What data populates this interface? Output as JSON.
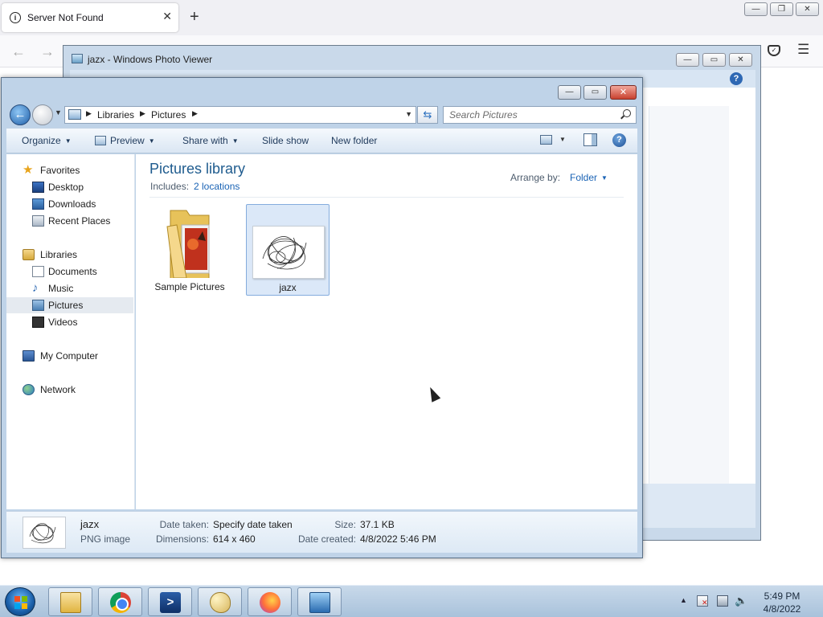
{
  "browser": {
    "tab_title": "Server Not Found",
    "tab_close": "✕",
    "new_tab": "+",
    "back": "←",
    "forward": "→",
    "menu": "☰"
  },
  "photo_viewer": {
    "title": "jazx - Windows Photo Viewer",
    "help": "?"
  },
  "explorer": {
    "address": {
      "crumbs": [
        "Libraries",
        "Pictures"
      ],
      "separator": "▶"
    },
    "search_placeholder": "Search Pictures",
    "toolbar": {
      "organize": "Organize",
      "preview": "Preview",
      "share_with": "Share with",
      "slide_show": "Slide show",
      "new_folder": "New folder",
      "help": "?"
    },
    "nav": {
      "favorites": "Favorites",
      "desktop": "Desktop",
      "downloads": "Downloads",
      "recent_places": "Recent Places",
      "libraries": "Libraries",
      "documents": "Documents",
      "music": "Music",
      "pictures": "Pictures",
      "videos": "Videos",
      "my_computer": "My Computer",
      "network": "Network"
    },
    "content": {
      "title": "Pictures library",
      "includes_label": "Includes:",
      "includes_link": "2 locations",
      "arrange_label": "Arrange by:",
      "arrange_value": "Folder",
      "items": [
        {
          "label": "Sample Pictures",
          "kind": "folder"
        },
        {
          "label": "jazx",
          "kind": "image",
          "selected": true
        }
      ]
    },
    "details": {
      "name": "jazx",
      "type": "PNG image",
      "date_taken_label": "Date taken:",
      "date_taken_value": "Specify date taken",
      "dimensions_label": "Dimensions:",
      "dimensions_value": "614 x 460",
      "size_label": "Size:",
      "size_value": "37.1 KB",
      "date_created_label": "Date created:",
      "date_created_value": "4/8/2022 5:46 PM"
    }
  },
  "taskbar": {
    "time": "5:49 PM",
    "date": "4/8/2022",
    "pinned": [
      "explorer-icon",
      "chrome-icon",
      "powershell-icon",
      "paint-icon",
      "firefox-icon",
      "photo-viewer-icon"
    ]
  },
  "colors": {
    "accent_blue": "#1a63b5",
    "library_title": "#1e5b8e",
    "close_red": "#c8412f"
  }
}
